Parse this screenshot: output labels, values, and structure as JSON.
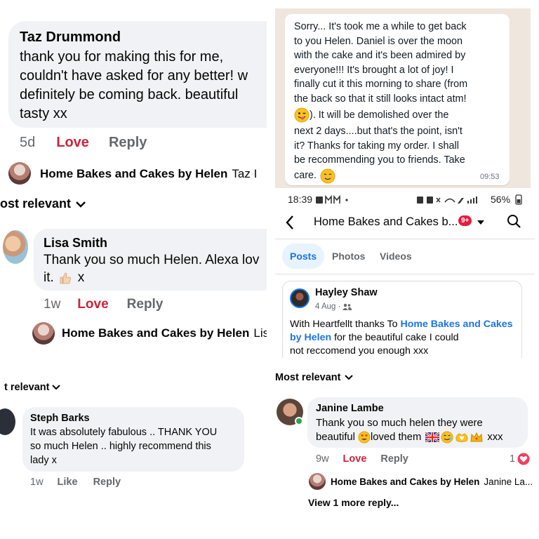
{
  "panel1": {
    "name": "Taz Drummond",
    "line1": "thank you for making this for me,",
    "line2": "couldn't have asked for any better! w",
    "line3": "definitely be coming back. beautiful",
    "line4": "tasty xx",
    "time": "5d",
    "love": "Love",
    "reply": "Reply",
    "page_name": "Home Bakes and Cakes by Helen",
    "reply_to": "Taz I"
  },
  "panel2": {
    "sort": "ost relevant",
    "name": "Lisa Smith",
    "line1": "Thank you so much Helen. Alexa lov",
    "line2": "it.",
    "line2_tail": "x",
    "time": "1w",
    "love": "Love",
    "reply": "Reply",
    "page_name": "Home Bakes and Cakes by Helen",
    "reply_to": "Lisa"
  },
  "panel3": {
    "lines": [
      "Sorry... It's took me a while to get back",
      "to you Helen. Daniel is over the moon",
      "with the cake and it's been admired by",
      "everyone!!! It's brought a lot of joy! I",
      "finally cut it this morning to share (from",
      "the back so that it still looks intact atm!"
    ],
    "line7": "). It will be demolished over the",
    "lines_after": [
      "next 2 days....but that's the point, isn't",
      "it? Thanks for taking my order. I shall",
      "be recommending you to friends. Take"
    ],
    "last_line": "care.",
    "timestamp": "09:53"
  },
  "panel4": {
    "status_time": "18:39",
    "battery": "56%",
    "page_title": "Home Bakes and Cakes b...",
    "notif_badge": "9+",
    "tabs": [
      "Posts",
      "Photos",
      "Videos"
    ],
    "author": "Hayley Shaw",
    "date": "4 Aug ·",
    "text_pre": "With Heartfellt thanks To ",
    "link": "Home Bakes and Cakes by Helen",
    "text_post": " for the beautiful cake  I could",
    "text_cut": "not reccomend you enough xxx"
  },
  "panel5": {
    "sort": "t relevant",
    "name": "Steph Barks",
    "line1": "It was absolutely fabulous .. THANK YOU",
    "line2": "so much Helen .. highly recommend this",
    "line3": "lady x",
    "time": "1w",
    "like": "Like",
    "reply": "Reply"
  },
  "panel6": {
    "sort": "Most relevant",
    "name": "Janine Lambe",
    "line1": "Thank you so much helen they were",
    "line2a": "beautiful",
    "line2b": "loved them",
    "line2c": "xxx",
    "time": "9w",
    "love": "Love",
    "reply": "Reply",
    "react_count": "1",
    "page_name": "Home Bakes and Cakes by Helen",
    "reply_to": "Janine La...",
    "more": "View 1 more reply..."
  },
  "colors": {
    "bubble": "#f0f2f5",
    "love": "#c9253c",
    "meta": "#65676b",
    "link": "#1b74e4",
    "whatsapp_bg": "#efe7de",
    "active_tab_bg": "#e7f3ff"
  }
}
